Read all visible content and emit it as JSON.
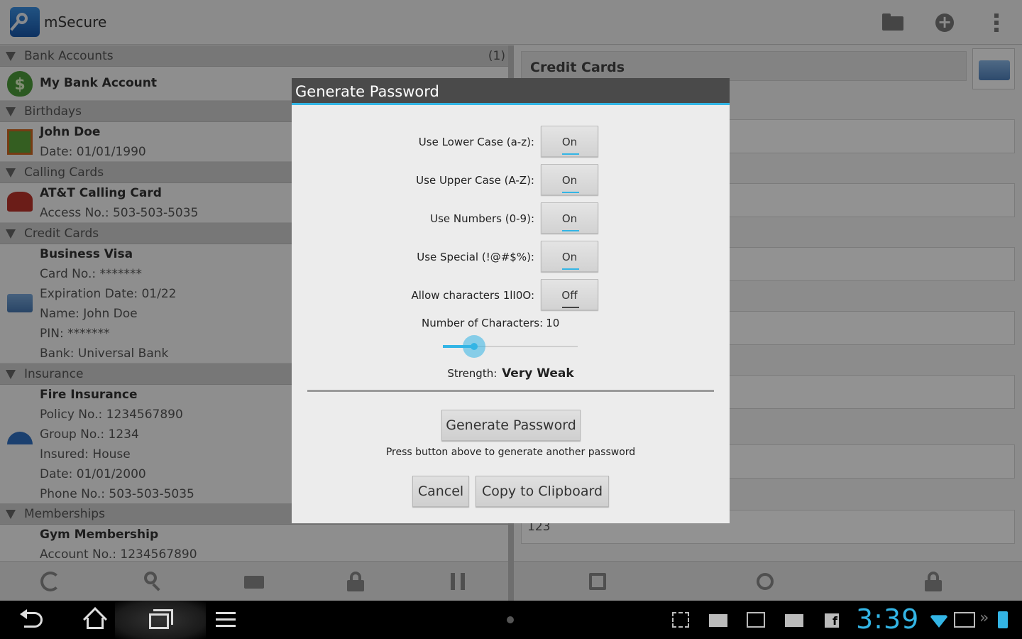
{
  "app": {
    "title": "mSecure",
    "actions": [
      "folder-icon",
      "add-icon",
      "overflow-menu-icon"
    ]
  },
  "sections": [
    {
      "name": "Bank Accounts",
      "count": "(1)",
      "items": [
        {
          "lines": [
            "My Bank Account"
          ],
          "icon": "money-bag-icon"
        }
      ]
    },
    {
      "name": "Birthdays",
      "items": [
        {
          "lines": [
            "John Doe",
            "Date: 01/01/1990"
          ],
          "icon": "gift-icon"
        }
      ]
    },
    {
      "name": "Calling Cards",
      "items": [
        {
          "lines": [
            "AT&T Calling Card",
            "Access No.: 503-503-5035"
          ],
          "icon": "telephone-icon"
        }
      ]
    },
    {
      "name": "Credit Cards",
      "items": [
        {
          "lines": [
            "Business Visa",
            "Card No.: *******",
            "Expiration Date: 01/22",
            "Name: John Doe",
            "PIN: *******",
            "Bank: Universal Bank"
          ],
          "icon": "credit-card-icon"
        }
      ]
    },
    {
      "name": "Insurance",
      "items": [
        {
          "lines": [
            "Fire Insurance",
            "Policy No.: 1234567890",
            "Group No.: 1234",
            "Insured: House",
            "Date: 01/01/2000",
            "Phone No.: 503-503-5035"
          ],
          "icon": "umbrella-icon"
        }
      ]
    },
    {
      "name": "Memberships",
      "items": [
        {
          "lines": [
            "Gym Membership",
            "Account No.: 1234567890"
          ],
          "icon": ""
        }
      ]
    }
  ],
  "detail": {
    "header": "Credit Cards",
    "visible_field_value": "123"
  },
  "dialog": {
    "title": "Generate Password",
    "options": [
      {
        "label": "Use Lower Case (a-z):",
        "state": "On"
      },
      {
        "label": "Use Upper Case (A-Z):",
        "state": "On"
      },
      {
        "label": "Use Numbers (0-9):",
        "state": "On"
      },
      {
        "label": "Use Special (!@#$%):",
        "state": "On"
      },
      {
        "label": "Allow characters 1lI0O:",
        "state": "Off"
      }
    ],
    "num_chars_label": "Number of Characters:",
    "num_chars_value": "10",
    "slider_level": 0.23,
    "strength_label": "Strength:",
    "strength_value": "Very Weak",
    "generate_button": "Generate Password",
    "press_note": "Press button above to generate another password",
    "cancel_button": "Cancel",
    "copy_button": "Copy to Clipboard"
  },
  "statusbar": {
    "time": "3:39"
  },
  "colors": {
    "accent": "#33b5e5",
    "dialog_title_bg": "#4a4a4a"
  }
}
